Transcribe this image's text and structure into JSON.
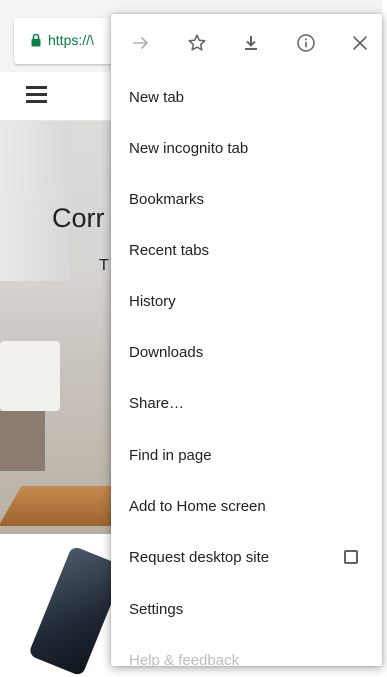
{
  "browser": {
    "url_text": "https://\\",
    "theme_color": "#0b8043"
  },
  "page": {
    "hero_title": "Corr",
    "hero_subtitle": "T"
  },
  "menu": {
    "toolbar_icons": [
      "forward-arrow-icon",
      "star-icon",
      "download-icon",
      "info-icon",
      "close-icon"
    ],
    "items": [
      {
        "label": "New tab"
      },
      {
        "label": "New incognito tab"
      },
      {
        "label": "Bookmarks"
      },
      {
        "label": "Recent tabs"
      },
      {
        "label": "History"
      },
      {
        "label": "Downloads"
      },
      {
        "label": "Share…"
      },
      {
        "label": "Find in page"
      },
      {
        "label": "Add to Home screen"
      },
      {
        "label": "Request desktop site",
        "checkbox_checked": false
      },
      {
        "label": "Settings"
      },
      {
        "label": "Help & feedback"
      }
    ]
  }
}
